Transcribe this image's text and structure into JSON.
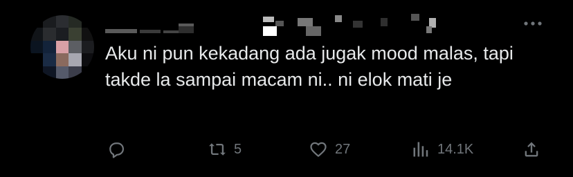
{
  "tweet": {
    "text": "Aku ni pun kekadang ada jugak mood malas, tapi takde la sampai macam ni.. ni elok mati je",
    "more_icon": "more-horizontal-icon"
  },
  "actions": {
    "reply": {
      "icon": "reply-icon",
      "count": ""
    },
    "retweet": {
      "icon": "retweet-icon",
      "count": "5"
    },
    "like": {
      "icon": "heart-icon",
      "count": "27"
    },
    "views": {
      "icon": "views-chart-icon",
      "count": "14.1K"
    },
    "share": {
      "icon": "share-icon",
      "count": ""
    }
  },
  "colors": {
    "background": "#000000",
    "text": "#e7e9ea",
    "muted": "#71767b"
  }
}
